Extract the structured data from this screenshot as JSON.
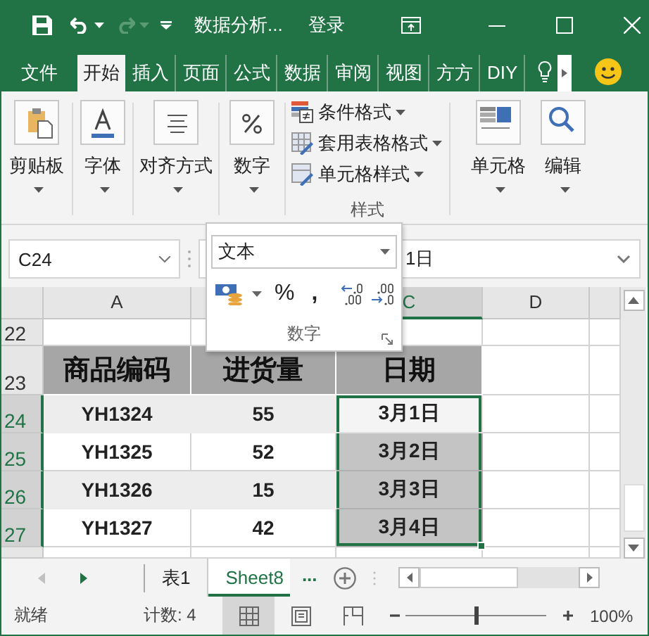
{
  "title_bar": {
    "title": "数据分析...",
    "account": "登录"
  },
  "ribbon_tabs": [
    {
      "label": "文件",
      "selected": false
    },
    {
      "label": "开始",
      "selected": true
    },
    {
      "label": "插入",
      "selected": false
    },
    {
      "label": "页面",
      "selected": false
    },
    {
      "label": "公式",
      "selected": false
    },
    {
      "label": "数据",
      "selected": false
    },
    {
      "label": "审阅",
      "selected": false
    },
    {
      "label": "视图",
      "selected": false
    },
    {
      "label": "方方",
      "selected": false
    },
    {
      "label": "DIY",
      "selected": false
    }
  ],
  "ribbon": {
    "left_buttons": [
      {
        "label": "剪贴板"
      },
      {
        "label": "字体"
      },
      {
        "label": "对齐方式"
      },
      {
        "label": "数字"
      }
    ],
    "styles_group": {
      "items": [
        "条件格式",
        "套用表格格式",
        "单元格样式"
      ],
      "label": "样式"
    },
    "right_buttons": [
      {
        "label": "单元格"
      },
      {
        "label": "编辑"
      }
    ]
  },
  "formula_bar": {
    "name_box": "C24",
    "formula": "1日"
  },
  "number_popup": {
    "format": "文本",
    "percent": "%",
    "comma": ",",
    "label": "数字"
  },
  "sheet": {
    "columns": [
      {
        "label": "A",
        "selected": false
      },
      {
        "selected": false
      },
      {
        "label": "C",
        "selected": true
      },
      {
        "label": "D",
        "selected": false
      }
    ],
    "rows": [
      {
        "number": "22",
        "kind": "blank",
        "selected": false
      },
      {
        "number": "23",
        "kind": "header",
        "selected": false,
        "cells": [
          {
            "text": "商品编码"
          },
          {
            "text": "进货量"
          },
          {
            "text": "日期"
          }
        ]
      },
      {
        "number": "24",
        "kind": "data",
        "selected": true,
        "shaded": true,
        "cells": [
          {
            "text": "YH1324",
            "selected": false,
            "active": false
          },
          {
            "text": "55",
            "selected": false,
            "active": false
          },
          {
            "text": "3月1日",
            "selected": true,
            "active": true
          }
        ]
      },
      {
        "number": "25",
        "kind": "data",
        "selected": true,
        "shaded": false,
        "cells": [
          {
            "text": "YH1325",
            "selected": false,
            "active": false
          },
          {
            "text": "52",
            "selected": false,
            "active": false
          },
          {
            "text": "3月2日",
            "selected": true,
            "active": false
          }
        ]
      },
      {
        "number": "26",
        "kind": "data",
        "selected": true,
        "shaded": true,
        "cells": [
          {
            "text": "YH1326",
            "selected": false,
            "active": false
          },
          {
            "text": "15",
            "selected": false,
            "active": false
          },
          {
            "text": "3月3日",
            "selected": true,
            "active": false
          }
        ]
      },
      {
        "number": "27",
        "kind": "data",
        "selected": true,
        "shaded": false,
        "cells": [
          {
            "text": "YH1327",
            "selected": false,
            "active": false
          },
          {
            "text": "42",
            "selected": false,
            "active": false
          },
          {
            "text": "3月4日",
            "selected": true,
            "active": false
          }
        ]
      }
    ]
  },
  "sheet_tabs": {
    "tabs": [
      {
        "label": "表1",
        "selected": false
      },
      {
        "label": "Sheet8",
        "selected": true
      }
    ],
    "more": "..."
  },
  "status_bar": {
    "status": "就绪",
    "count": "计数: 4",
    "views": [
      {
        "selected": true
      },
      {
        "selected": false
      },
      {
        "selected": false
      }
    ],
    "zoom": {
      "level": 0.5,
      "reading": "100%"
    }
  }
}
